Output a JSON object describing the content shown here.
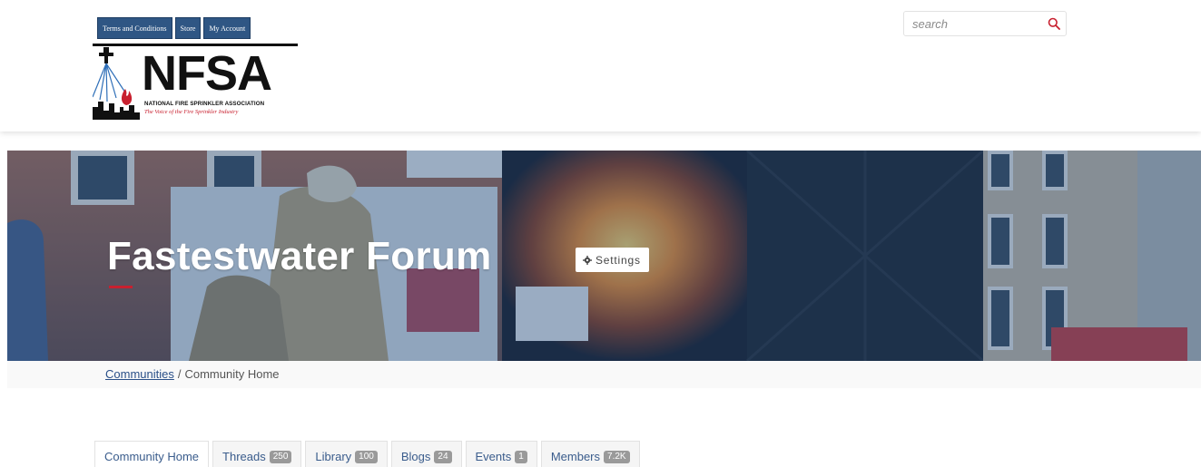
{
  "header": {
    "top_links": [
      "Terms and Conditions",
      "Store",
      "My Account"
    ],
    "logo": {
      "title": "NFSA",
      "subtitle": "NATIONAL FIRE SPRINKLER ASSOCIATION",
      "tagline": "The Voice of the Fire Sprinkler Industry"
    },
    "search": {
      "placeholder": "search",
      "icon": "search-icon"
    }
  },
  "banner": {
    "title": "Fastestwater Forum",
    "settings_label": "Settings",
    "settings_icon": "gear-icon"
  },
  "breadcrumb": {
    "link": "Communities",
    "separator": "/",
    "current": "Community Home"
  },
  "tabs": [
    {
      "label": "Community Home",
      "badge": null
    },
    {
      "label": "Threads",
      "badge": "250"
    },
    {
      "label": "Library",
      "badge": "100"
    },
    {
      "label": "Blogs",
      "badge": "24"
    },
    {
      "label": "Events",
      "badge": "1"
    },
    {
      "label": "Members",
      "badge": "7.2K"
    }
  ],
  "colors": {
    "brand_blue": "#2f5684",
    "accent_red": "#c8202f",
    "banner_tint": "#1a4980"
  }
}
